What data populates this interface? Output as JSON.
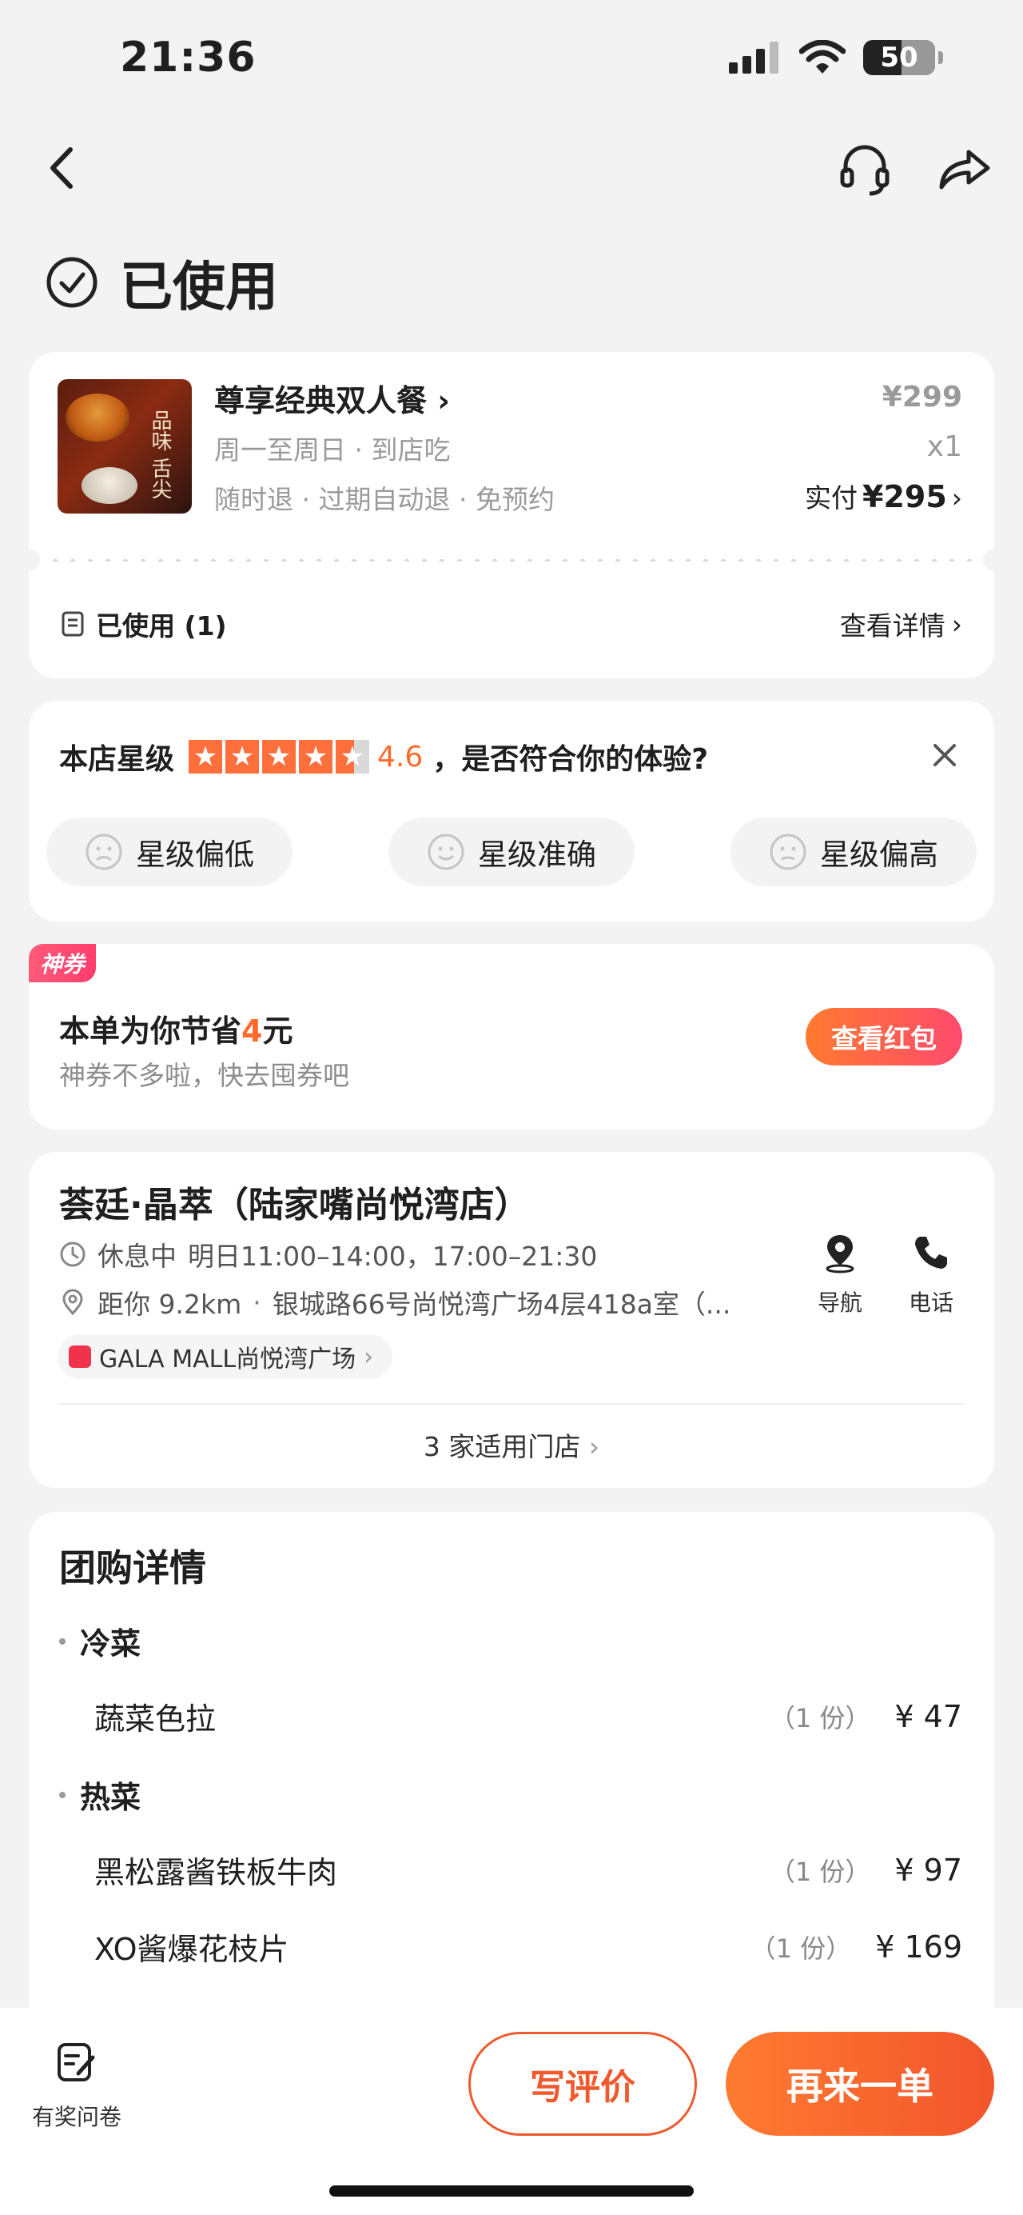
{
  "status_bar": {
    "time": "21:36",
    "battery": "50"
  },
  "page_status": "已使用",
  "order": {
    "name": "尊享经典双人餐",
    "sub1": "周一至周日 · 到店吃",
    "sub2": "随时退 · 过期自动退 · 免预约",
    "price": "¥299",
    "qty": "x1",
    "paid_label": "实付",
    "paid_amount": "¥295",
    "used_label": "已使用 (1)",
    "detail_label": "查看详情",
    "image_text": "品味 舌尖"
  },
  "rating": {
    "label": "本店星级",
    "score": "4.6",
    "question": "，是否符合你的体验?",
    "options": [
      "星级偏低",
      "星级准确",
      "星级偏高"
    ],
    "stars": 4.6
  },
  "coupon": {
    "tag": "神券",
    "headline_pre": "本单为你节省",
    "headline_num": "4",
    "headline_post": "元",
    "sub": "神券不多啦，快去囤券吧",
    "button": "查看红包"
  },
  "store": {
    "name": "荟廷·晶萃（陆家嘴尚悦湾店）",
    "hours_status": "休息中",
    "hours": "明日11:00–14:00，17:00–21:30",
    "distance": "距你 9.2km",
    "address": "银城路66号尚悦湾广场4层418a室（...",
    "mall": "GALA MALL尚悦湾广场",
    "nav_label": "导航",
    "phone_label": "电话",
    "more_stores": "3 家适用门店"
  },
  "details": {
    "title": "团购详情",
    "cat1": "冷菜",
    "cat2": "热菜",
    "items": [
      {
        "name": "蔬菜色拉",
        "qty": "（1 份）",
        "price": "¥ 47"
      },
      {
        "name": "黑松露酱铁板牛肉",
        "qty": "（1 份）",
        "price": "¥ 97"
      },
      {
        "name": "XO酱爆花枝片",
        "qty": "（1 份）",
        "price": "¥ 169"
      }
    ]
  },
  "bottom": {
    "survey": "有奖问卷",
    "review": "写评价",
    "again": "再来一单"
  },
  "colors": {
    "accent": "#ff6a2b",
    "pink": "#ff4a6d"
  }
}
